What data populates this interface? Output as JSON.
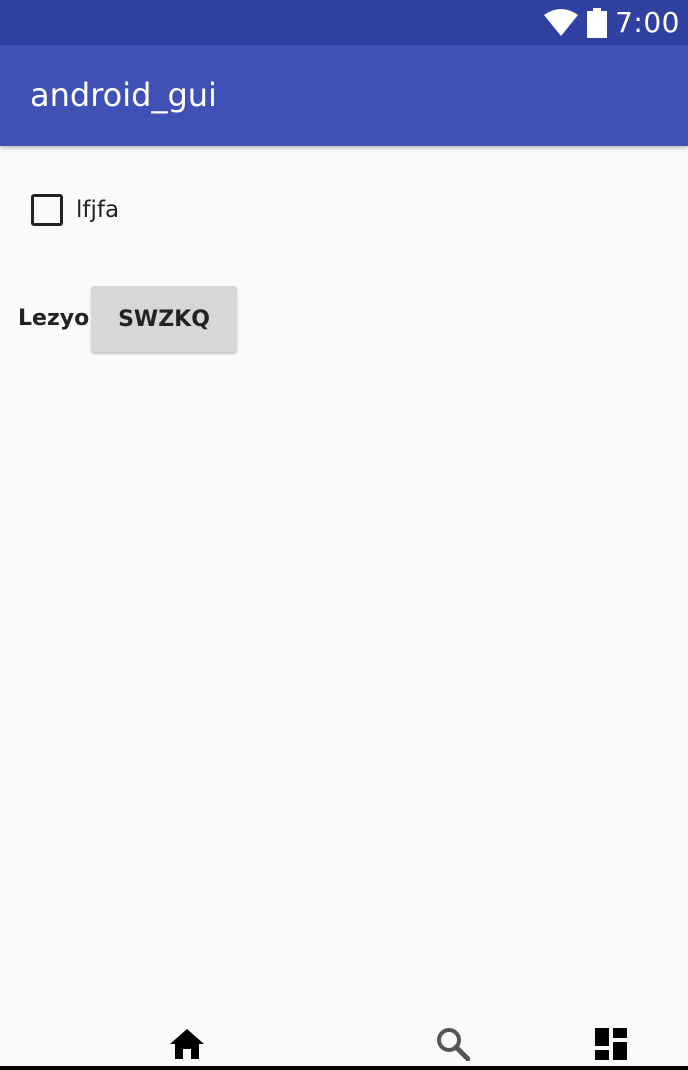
{
  "status_bar": {
    "time": "7:00",
    "icons": [
      "wifi-icon",
      "battery-icon"
    ],
    "background": "#3040a0"
  },
  "app_bar": {
    "title": "android_gui",
    "background": "#3f51b5"
  },
  "content": {
    "checkbox": {
      "label": "lfjfa",
      "checked": false
    },
    "field_label": "Lezyo",
    "button_label": "SWZKQ"
  },
  "nav_bar": {
    "items": [
      "home-icon",
      "search-icon",
      "dashboard-icon"
    ]
  }
}
